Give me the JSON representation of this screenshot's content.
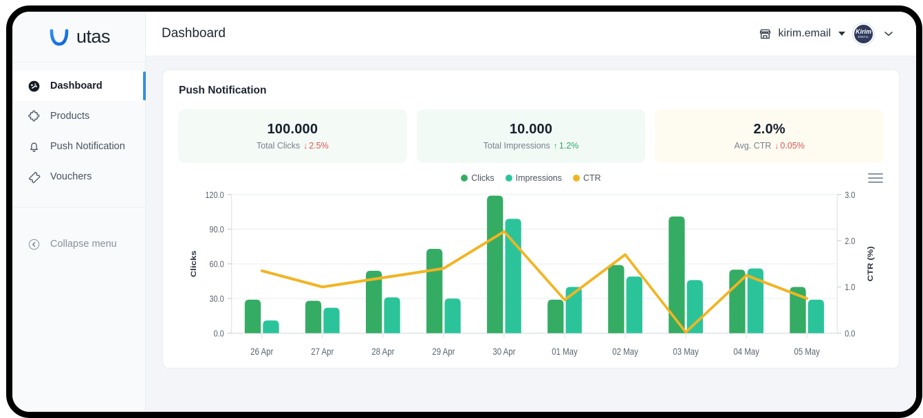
{
  "brand": {
    "name": "utas",
    "logo_icon": "utas-logo-icon"
  },
  "sidebar": {
    "items": [
      {
        "label": "Dashboard",
        "icon": "speedometer-icon",
        "active": true
      },
      {
        "label": "Products",
        "icon": "puzzle-piece-icon",
        "active": false
      },
      {
        "label": "Push Notification",
        "icon": "bell-icon",
        "active": false
      },
      {
        "label": "Vouchers",
        "icon": "ticket-icon",
        "active": false
      }
    ],
    "collapse": {
      "label": "Collapse menu",
      "icon": "collapse-left-icon"
    }
  },
  "topbar": {
    "title": "Dashboard",
    "store": {
      "label": "kirim.email",
      "icon": "storefront-icon"
    },
    "avatar": {
      "line1": "Kirim",
      "line2": "EMAIL"
    }
  },
  "panel": {
    "title": "Push Notification",
    "stats": [
      {
        "value": "100.000",
        "label": "Total Clicks",
        "delta": "2.5%",
        "direction": "down",
        "arrow": "↓",
        "bg": "#f4faf6"
      },
      {
        "value": "10.000",
        "label": "Total Impressions",
        "delta": "1.2%",
        "direction": "up",
        "arrow": "↑",
        "bg": "#f2faf6"
      },
      {
        "value": "2.0%",
        "label": "Avg. CTR",
        "delta": "0.05%",
        "direction": "down",
        "arrow": "↓",
        "bg": "#fefbf1"
      }
    ]
  },
  "colors": {
    "clicks": "#34ac63",
    "impressions": "#2bc49a",
    "ctr": "#f2b422",
    "up": "#2eaa63",
    "down": "#e3524f",
    "accent": "#3490dc"
  },
  "chart_data": {
    "type": "bar",
    "title": "",
    "xlabel": "",
    "ylabel": "Clicks",
    "y2label": "CTR (%)",
    "ylim": [
      0,
      120
    ],
    "y2lim": [
      0,
      3
    ],
    "yticks": [
      "0.0",
      "30.0",
      "60.0",
      "90.0",
      "120.0"
    ],
    "y2ticks": [
      "0.0",
      "1.0",
      "2.0",
      "3.0"
    ],
    "grid": true,
    "legend_position": "top-center",
    "categories": [
      "26 Apr",
      "27 Apr",
      "28 Apr",
      "29 Apr",
      "30 Apr",
      "01 May",
      "02 May",
      "03 May",
      "04 May",
      "05 May"
    ],
    "series": [
      {
        "name": "Clicks",
        "type": "column",
        "axis": "left",
        "color": "#34ac63",
        "values": [
          29,
          28,
          54,
          73,
          119,
          29,
          59,
          101,
          55,
          40
        ]
      },
      {
        "name": "Impressions",
        "type": "column",
        "axis": "left",
        "color": "#2bc49a",
        "values": [
          11,
          22,
          31,
          30,
          99,
          40,
          49,
          46,
          56,
          29
        ]
      },
      {
        "name": "CTR",
        "type": "line",
        "axis": "right",
        "color": "#f2b422",
        "values": [
          1.35,
          1.0,
          1.2,
          1.4,
          2.2,
          0.72,
          1.7,
          0.02,
          1.25,
          0.75
        ]
      }
    ]
  }
}
